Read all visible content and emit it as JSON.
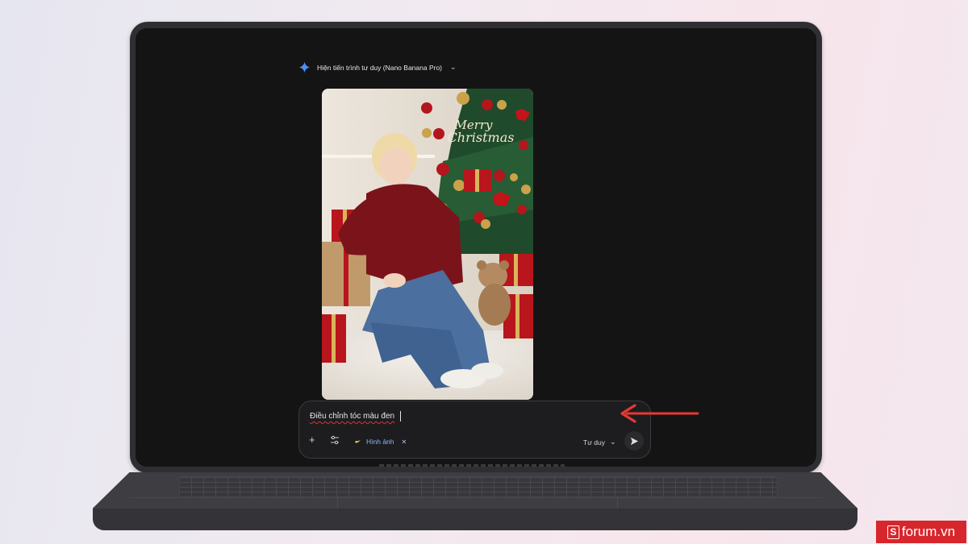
{
  "header": {
    "thinking_label": "Hiện tiến trình tư duy (Nano Banana Pro)",
    "spark_icon": "gemini-spark-icon",
    "chevron_icon": "chevron-down-icon"
  },
  "image": {
    "overlay_text_line1": "Merry",
    "overlay_text_line2": "Christmas"
  },
  "prompt": {
    "value": "Điều chỉnh tóc màu đen",
    "tools": {
      "add_icon": "plus-icon",
      "settings_icon": "tune-icon",
      "chip_label": "Hình ảnh",
      "chip_icon": "banana-icon",
      "chip_remove_icon": "close-icon",
      "mode_label": "Tư duy",
      "mode_icon": "chevron-down-icon",
      "send_icon": "send-icon"
    }
  },
  "watermark": {
    "badge": "S",
    "text": "forum.vn"
  },
  "colors": {
    "accent_blue": "#4c8df6",
    "chip_blue": "#8fb8ff",
    "arrow_red": "#e53935",
    "watermark_red": "#d7262c"
  }
}
